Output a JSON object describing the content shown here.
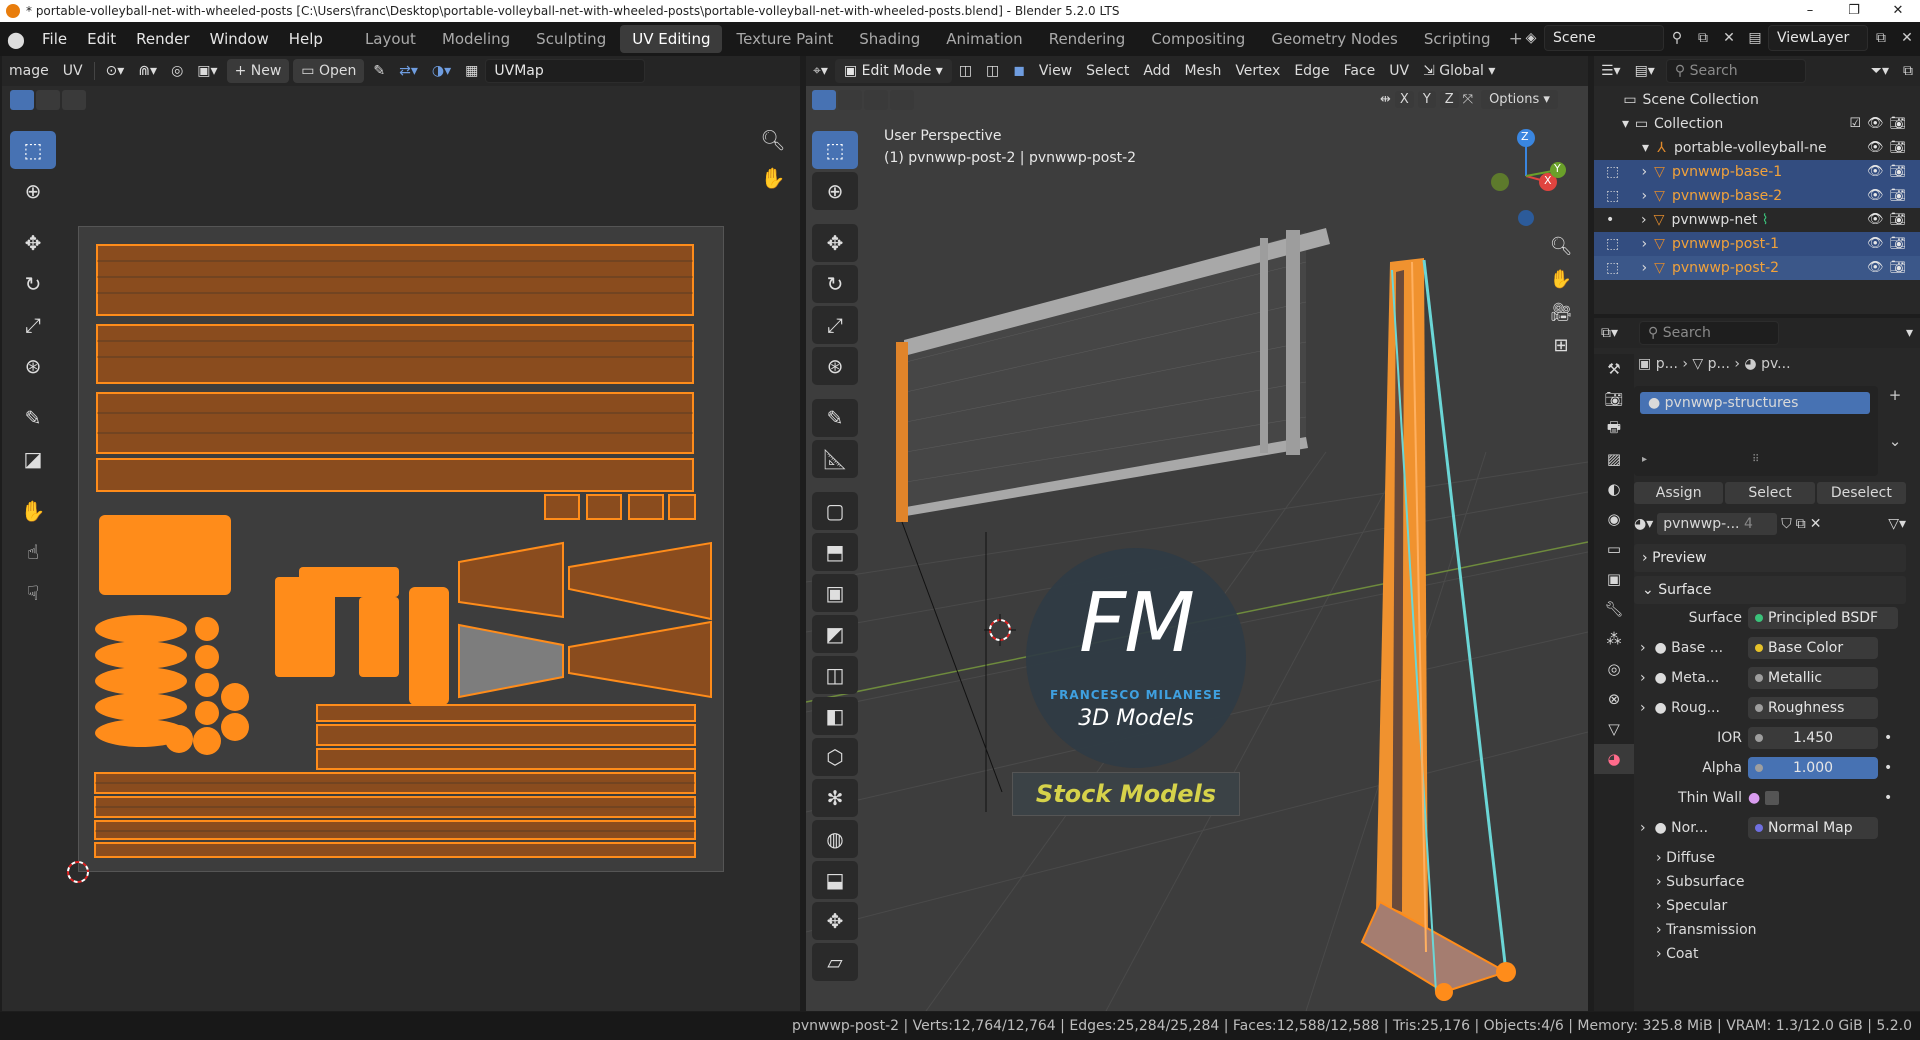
{
  "window": {
    "title": "* portable-volleyball-net-with-wheeled-posts [C:\\Users\\franc\\Desktop\\portable-volleyball-net-with-wheeled-posts\\portable-volleyball-net-with-wheeled-posts.blend] - Blender 5.2.0 LTS",
    "minimize": "–",
    "maximize": "❐",
    "close": "✕"
  },
  "menu": [
    "File",
    "Edit",
    "Render",
    "Window",
    "Help"
  ],
  "workspaces": [
    "Layout",
    "Modeling",
    "Sculpting",
    "UV Editing",
    "Texture Paint",
    "Shading",
    "Animation",
    "Rendering",
    "Compositing",
    "Geometry Nodes",
    "Scripting"
  ],
  "workspace_plus": "+",
  "scene": {
    "label": "Scene",
    "viewlayer": "ViewLayer"
  },
  "uv_editor": {
    "header": {
      "image_menu": "mage",
      "uv_menu": "UV",
      "new_label": "New",
      "open_label": "Open",
      "uvmap": "UVMap"
    }
  },
  "viewport": {
    "header": {
      "mode": "Edit Mode",
      "menus": [
        "View",
        "Select",
        "Add",
        "Mesh",
        "Vertex",
        "Edge",
        "Face",
        "UV"
      ],
      "transform": "Global",
      "axes": [
        "X",
        "Y",
        "Z"
      ],
      "options": "Options"
    },
    "overlay_line1": "User Perspective",
    "overlay_line2": "(1) pvnwwp-post-2 | pvnwwp-post-2",
    "gizmo": {
      "z": "Z",
      "x": "X",
      "y": "Y"
    },
    "watermark": {
      "letters": "FM",
      "name": "FRANCESCO MILANESE",
      "sub": "3D Models",
      "badge": "Stock Models"
    }
  },
  "outliner": {
    "search_placeholder": "Search",
    "scene_collection": "Scene Collection",
    "collection": "Collection",
    "items": [
      {
        "label": "portable-volleyball-ne",
        "selected": false
      },
      {
        "label": "pvnwwp-base-1",
        "selected": true
      },
      {
        "label": "pvnwwp-base-2",
        "selected": true
      },
      {
        "label": "pvnwwp-net",
        "selected": false
      },
      {
        "label": "pvnwwp-post-1",
        "selected": true
      },
      {
        "label": "pvnwwp-post-2",
        "selected": true
      }
    ]
  },
  "properties": {
    "search_placeholder": "Search",
    "breadcrumb": [
      "p...",
      "p...",
      "pv..."
    ],
    "material_slot": "pvnwwp-structures",
    "assign": "Assign",
    "select": "Select",
    "deselect": "Deselect",
    "material_name": "pvnwwp-...",
    "users": "4",
    "preview": "Preview",
    "surface_section": "Surface",
    "surface_label": "Surface",
    "surface_value": "Principled BSDF",
    "rows": [
      {
        "label": "Base ...",
        "value": "Base Color",
        "dot": "#e6c229"
      },
      {
        "label": "Meta...",
        "value": "Metallic",
        "dot": "#9e9e9e"
      },
      {
        "label": "Roug...",
        "value": "Roughness",
        "dot": "#9e9e9e"
      }
    ],
    "ior_label": "IOR",
    "ior_value": "1.450",
    "alpha_label": "Alpha",
    "alpha_value": "1.000",
    "thin_wall": "Thin Wall",
    "normal_label": "Nor...",
    "normal_value": "Normal Map",
    "subsections": [
      "Diffuse",
      "Subsurface",
      "Specular",
      "Transmission",
      "Coat"
    ]
  },
  "status": {
    "object": "pvnwwp-post-2",
    "verts": "Verts:12,764/12,764",
    "edges": "Edges:25,284/25,284",
    "faces": "Faces:12,588/12,588",
    "tris": "Tris:25,176",
    "objects": "Objects:4/6",
    "memory": "Memory: 325.8 MiB",
    "vram": "VRAM: 1.3/12.0 GiB",
    "version": "5.2.0"
  }
}
